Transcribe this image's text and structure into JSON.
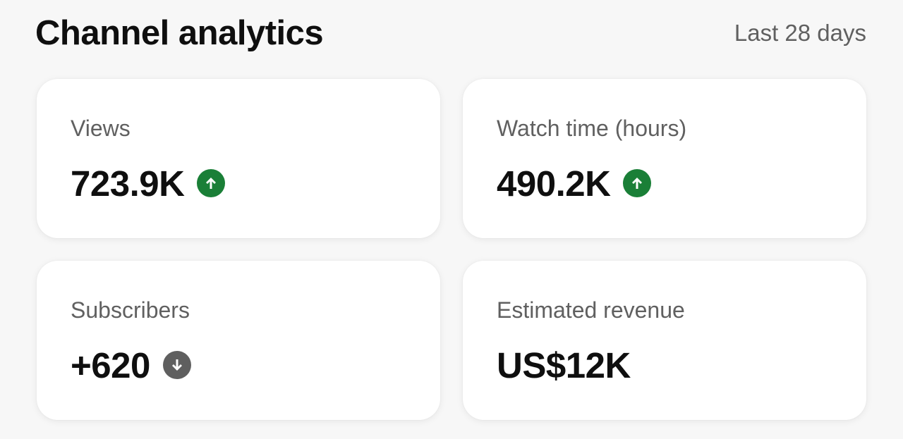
{
  "header": {
    "title": "Channel analytics",
    "period": "Last 28 days"
  },
  "cards": [
    {
      "label": "Views",
      "value": "723.9K",
      "trend": "up",
      "trend_icon": "arrow-up-icon"
    },
    {
      "label": "Watch time (hours)",
      "value": "490.2K",
      "trend": "up",
      "trend_icon": "arrow-up-icon"
    },
    {
      "label": "Subscribers",
      "value": "+620",
      "trend": "down",
      "trend_icon": "arrow-down-icon"
    },
    {
      "label": "Estimated revenue",
      "value": "US$12K",
      "trend": "none"
    }
  ],
  "colors": {
    "trend_up": "#1a7f37",
    "trend_down": "#5f5f5f"
  }
}
